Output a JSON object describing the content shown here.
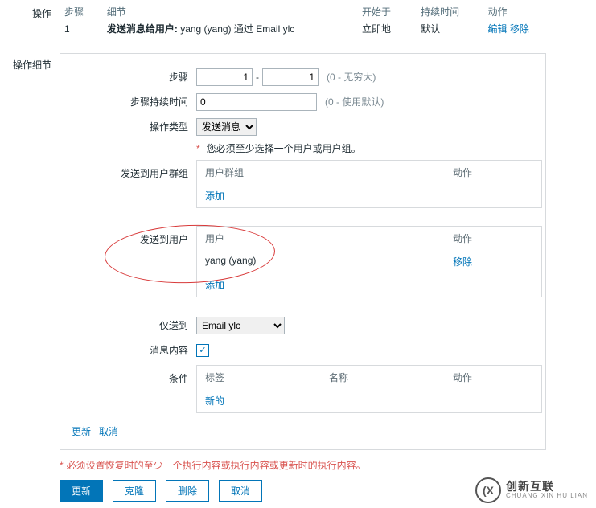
{
  "operations": {
    "label": "操作",
    "headers": {
      "step": "步骤",
      "detail": "细节",
      "start": "开始于",
      "duration": "持续时间",
      "action": "动作"
    },
    "row": {
      "step": "1",
      "detail_prefix": "发送消息给用户:",
      "detail_user": "yang (yang) 通过 Email ylc",
      "start": "立即地",
      "duration": "默认",
      "edit": "编辑",
      "remove": "移除"
    }
  },
  "detail": {
    "label": "操作细节",
    "step_label": "步骤",
    "step_from": "1",
    "step_dash": "-",
    "step_to": "1",
    "step_hint": "(0 - 无穷大)",
    "duration_label": "步骤持续时间",
    "duration_value": "0",
    "duration_hint": "(0 - 使用默认)",
    "optype_label": "操作类型",
    "optype_value": "发送消息",
    "must_select_note": "您必须至少选择一个用户或用户组。",
    "group_label": "发送到用户群组",
    "group_hdr_name": "用户群组",
    "group_hdr_action": "动作",
    "group_add": "添加",
    "user_label": "发送到用户",
    "user_hdr_name": "用户",
    "user_hdr_action": "动作",
    "user_value": "yang (yang)",
    "user_remove": "移除",
    "user_add": "添加",
    "sendto_label": "仅送到",
    "sendto_value": "Email ylc",
    "msgcontent_label": "消息内容",
    "msgcontent_checked": true,
    "condition_label": "条件",
    "cond_hdr_label": "标签",
    "cond_hdr_name": "名称",
    "cond_hdr_action": "动作",
    "cond_new": "新的",
    "inner_update": "更新",
    "inner_cancel": "取消"
  },
  "footer": {
    "note": "必须设置恢复时的至少一个执行内容或执行内容或更新时的执行内容。",
    "update": "更新",
    "clone": "克隆",
    "delete": "删除",
    "cancel": "取消"
  },
  "logo": {
    "main": "创新互联",
    "sub": "CHUANG XIN HU LIAN"
  }
}
